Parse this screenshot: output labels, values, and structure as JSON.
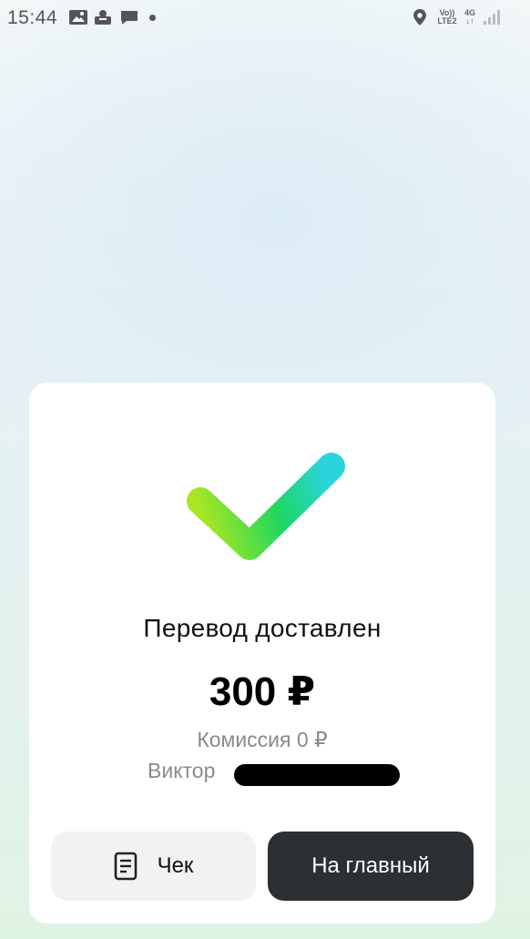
{
  "status_bar": {
    "time": "15:44",
    "icons": [
      "image-icon",
      "app-icon",
      "message-icon",
      "location-icon",
      "volte-icon",
      "4g-icon",
      "signal-icon"
    ],
    "volte_top": "Vo))",
    "volte_bottom": "LTE2",
    "network": "4G"
  },
  "card": {
    "title": "Перевод доставлен",
    "amount": "300 ₽",
    "commission": "Комиссия 0 ₽",
    "recipient": "Виктор"
  },
  "buttons": {
    "receipt_label": "Чек",
    "home_label": "На главный"
  },
  "colors": {
    "check_start": "#a6e622",
    "check_mid": "#1ed760",
    "check_end": "#2ad4dd",
    "home_button_bg": "#2c3033"
  }
}
